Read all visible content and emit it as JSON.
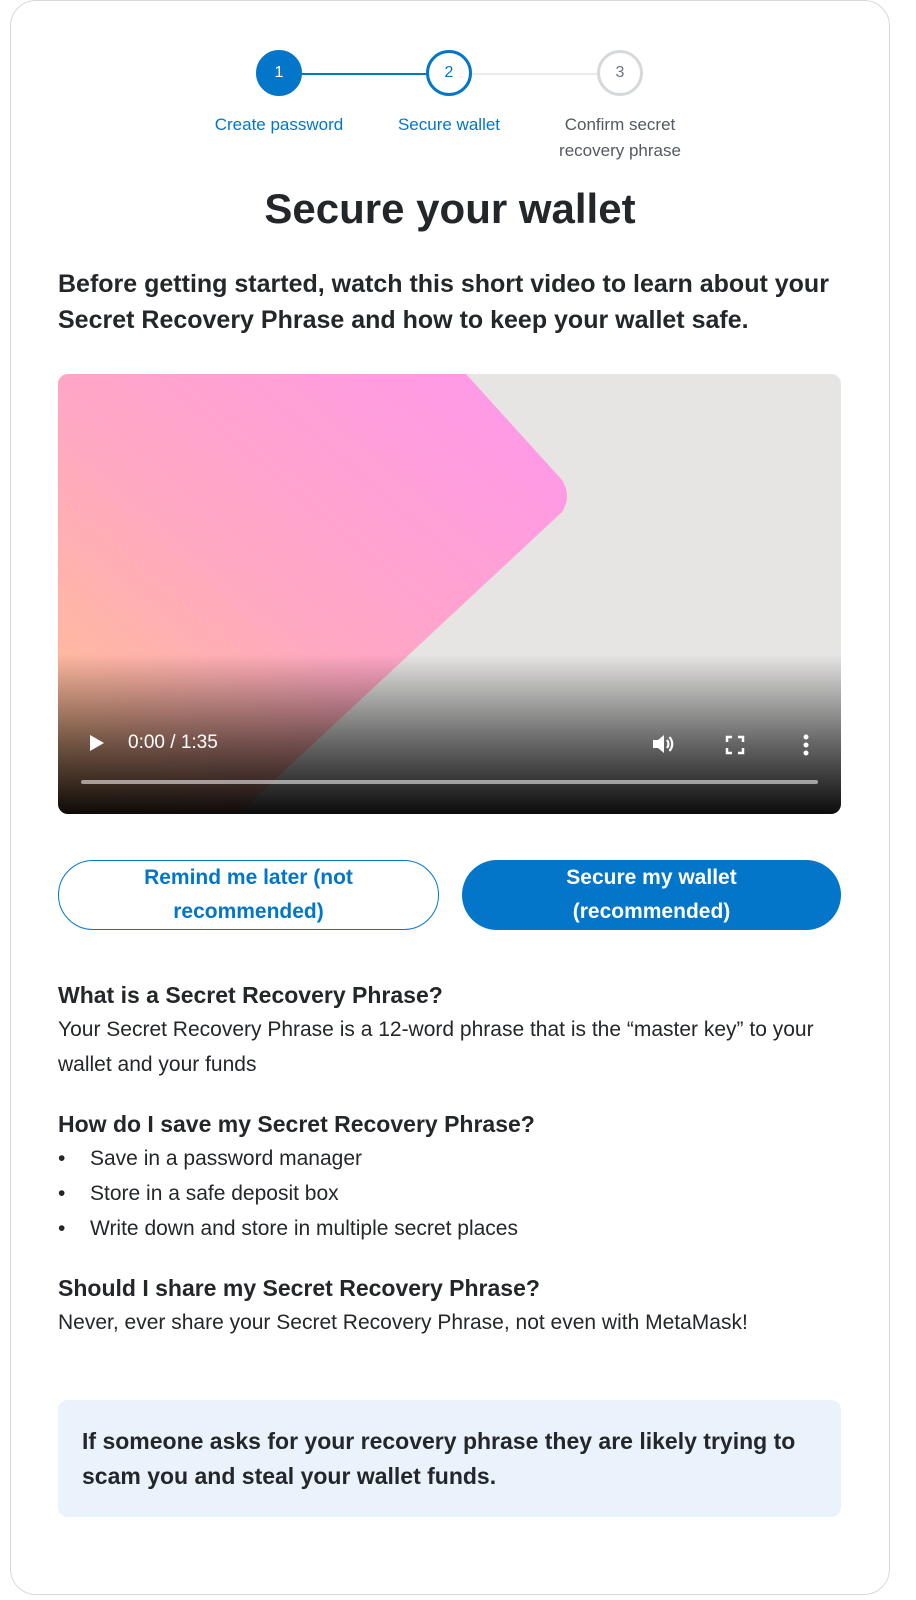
{
  "stepper": {
    "steps": [
      {
        "number": "1",
        "label": "Create password",
        "state": "completed"
      },
      {
        "number": "2",
        "label": "Secure wallet",
        "state": "active"
      },
      {
        "number": "3",
        "label_line1": "Confirm secret",
        "label_line2": "recovery phrase",
        "state": "pending"
      }
    ]
  },
  "title": "Secure your wallet",
  "intro": "Before getting started, watch this short video to learn about your Secret Recovery Phrase and how to keep your wallet safe.",
  "video": {
    "time": "0:00 / 1:35",
    "progress": 0,
    "controls": [
      "play-icon",
      "volume-icon",
      "fullscreen-icon",
      "more-vertical-icon"
    ]
  },
  "buttons": {
    "remind_later": "Remind me later (not recommended)",
    "secure_wallet": "Secure my wallet (recommended)"
  },
  "faq": {
    "q1": "What is a Secret Recovery Phrase?",
    "a1": "Your Secret Recovery Phrase is a 12-word phrase that is the “master key” to your wallet and your funds",
    "q2": "How do I save my Secret Recovery Phrase?",
    "a2_items": [
      "Save in a password manager",
      "Store in a safe deposit box",
      "Write down and store in multiple secret places"
    ],
    "q3": "Should I share my Secret Recovery Phrase?",
    "a3": "Never, ever share your Secret Recovery Phrase, not even with MetaMask!"
  },
  "warning": "If someone asks for your recovery phrase they are likely trying to scam you and steal your wallet funds.",
  "colors": {
    "accent": "#0376c9",
    "text": "#24272a",
    "warning_bg": "#eaf2fb"
  }
}
